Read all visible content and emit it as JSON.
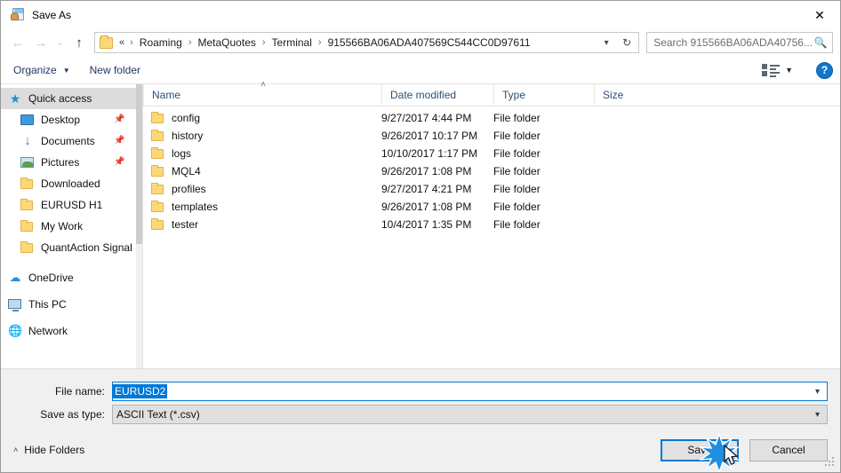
{
  "window": {
    "title": "Save As",
    "title_icon": "save-as-icon",
    "close_label": "✕"
  },
  "nav": {
    "back": "←",
    "forward": "→",
    "recent": "⌄",
    "up": "↑"
  },
  "address": {
    "folder_icon": "folder-icon",
    "overflow": "«",
    "separator": "›",
    "crumbs": [
      "Roaming",
      "MetaQuotes",
      "Terminal",
      "915566BA06ADA407569C544CC0D97611"
    ],
    "dropdown_icon": "chevron-down-icon",
    "refresh_icon": "↻"
  },
  "search": {
    "placeholder": "Search 915566BA06ADA40756...",
    "icon": "search-icon"
  },
  "toolbar": {
    "organize": "Organize",
    "organize_caret": "▼",
    "new_folder": "New folder",
    "view_icon": "view-options-icon",
    "view_caret": "▼",
    "help": "?"
  },
  "sidebar": {
    "items": [
      {
        "label": "Quick access",
        "icon": "star-icon",
        "selected": true,
        "indent": false,
        "pinned": false
      },
      {
        "label": "Desktop",
        "icon": "desktop-icon",
        "selected": false,
        "indent": true,
        "pinned": true
      },
      {
        "label": "Documents",
        "icon": "documents-icon",
        "selected": false,
        "indent": true,
        "pinned": true
      },
      {
        "label": "Pictures",
        "icon": "pictures-icon",
        "selected": false,
        "indent": true,
        "pinned": true
      },
      {
        "label": "Downloaded",
        "icon": "folder-icon",
        "selected": false,
        "indent": true,
        "pinned": false
      },
      {
        "label": "EURUSD H1",
        "icon": "folder-icon",
        "selected": false,
        "indent": true,
        "pinned": false
      },
      {
        "label": "My Work",
        "icon": "folder-icon",
        "selected": false,
        "indent": true,
        "pinned": false
      },
      {
        "label": "QuantAction Signal",
        "icon": "folder-icon",
        "selected": false,
        "indent": true,
        "pinned": false
      },
      {
        "label": "OneDrive",
        "icon": "cloud-icon",
        "selected": false,
        "indent": false,
        "pinned": false
      },
      {
        "label": "This PC",
        "icon": "computer-icon",
        "selected": false,
        "indent": false,
        "pinned": false
      },
      {
        "label": "Network",
        "icon": "network-icon",
        "selected": false,
        "indent": false,
        "pinned": false
      }
    ],
    "pin_glyph": "📌"
  },
  "filelist": {
    "sort_indicator": "˄",
    "columns": [
      "Name",
      "Date modified",
      "Type",
      "Size"
    ],
    "rows": [
      {
        "name": "config",
        "date": "9/27/2017 4:44 PM",
        "type": "File folder",
        "size": ""
      },
      {
        "name": "history",
        "date": "9/26/2017 10:17 PM",
        "type": "File folder",
        "size": ""
      },
      {
        "name": "logs",
        "date": "10/10/2017 1:17 PM",
        "type": "File folder",
        "size": ""
      },
      {
        "name": "MQL4",
        "date": "9/26/2017 1:08 PM",
        "type": "File folder",
        "size": ""
      },
      {
        "name": "profiles",
        "date": "9/27/2017 4:21 PM",
        "type": "File folder",
        "size": ""
      },
      {
        "name": "templates",
        "date": "9/26/2017 1:08 PM",
        "type": "File folder",
        "size": ""
      },
      {
        "name": "tester",
        "date": "10/4/2017 1:35 PM",
        "type": "File folder",
        "size": ""
      }
    ]
  },
  "bottom": {
    "file_name_label": "File name:",
    "file_name_value": "EURUSD2",
    "save_type_label": "Save as type:",
    "save_type_value": "ASCII Text (*.csv)",
    "caret_icon": "chevron-down-icon",
    "hide_folders": "Hide Folders",
    "hide_folders_caret": "˄",
    "save_label": "Save",
    "cancel_label": "Cancel"
  },
  "colors": {
    "accent": "#0078d7",
    "folder": "#fcd976",
    "header_text": "#2d5074",
    "toolbar_text": "#1f3864",
    "panel": "#f0f0f0",
    "selection": "#dcdcdc"
  }
}
